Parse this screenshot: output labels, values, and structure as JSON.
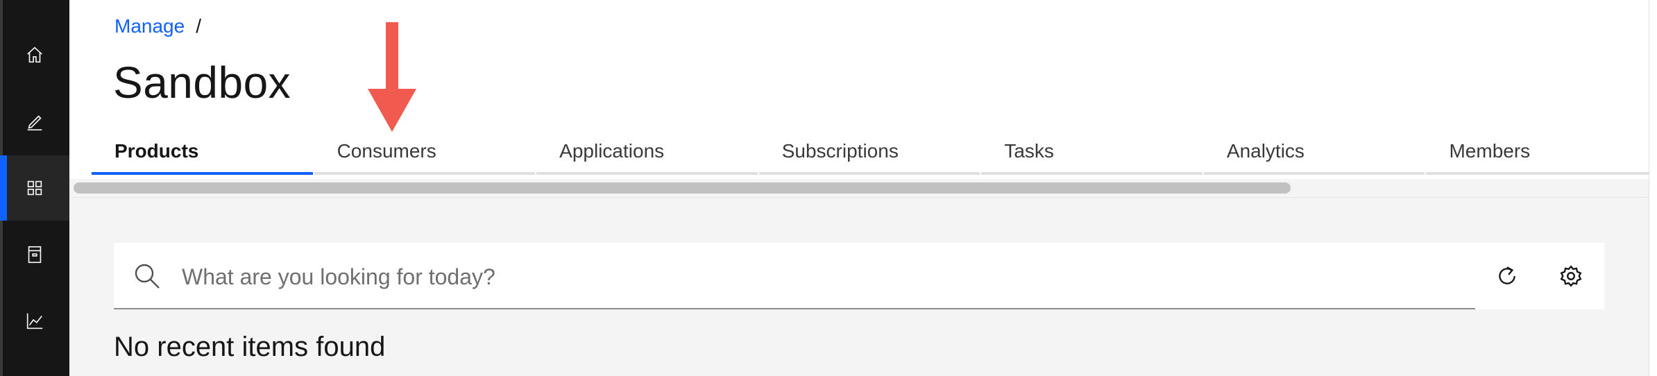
{
  "breadcrumb": {
    "parent": "Manage",
    "separator": "/"
  },
  "page": {
    "title": "Sandbox"
  },
  "tabs": [
    {
      "label": "Products",
      "active": true
    },
    {
      "label": "Consumers",
      "active": false
    },
    {
      "label": "Applications",
      "active": false
    },
    {
      "label": "Subscriptions",
      "active": false
    },
    {
      "label": "Tasks",
      "active": false
    },
    {
      "label": "Analytics",
      "active": false
    },
    {
      "label": "Members",
      "active": false
    }
  ],
  "left_nav": {
    "items": [
      {
        "icon": "home-icon",
        "active": false
      },
      {
        "icon": "edit-icon",
        "active": false
      },
      {
        "icon": "grid-icon",
        "active": true
      },
      {
        "icon": "archive-icon",
        "active": false
      },
      {
        "icon": "analytics-icon",
        "active": false
      }
    ]
  },
  "search": {
    "placeholder": "What are you looking for today?",
    "value": ""
  },
  "toolbar_icons": [
    "refresh-icon",
    "settings-icon"
  ],
  "empty_state": {
    "message": "No recent items found"
  },
  "colors": {
    "accent": "#0f62fe",
    "rail": "#161616",
    "annotation": "#f05a4f",
    "content_bg": "#f4f4f4"
  }
}
